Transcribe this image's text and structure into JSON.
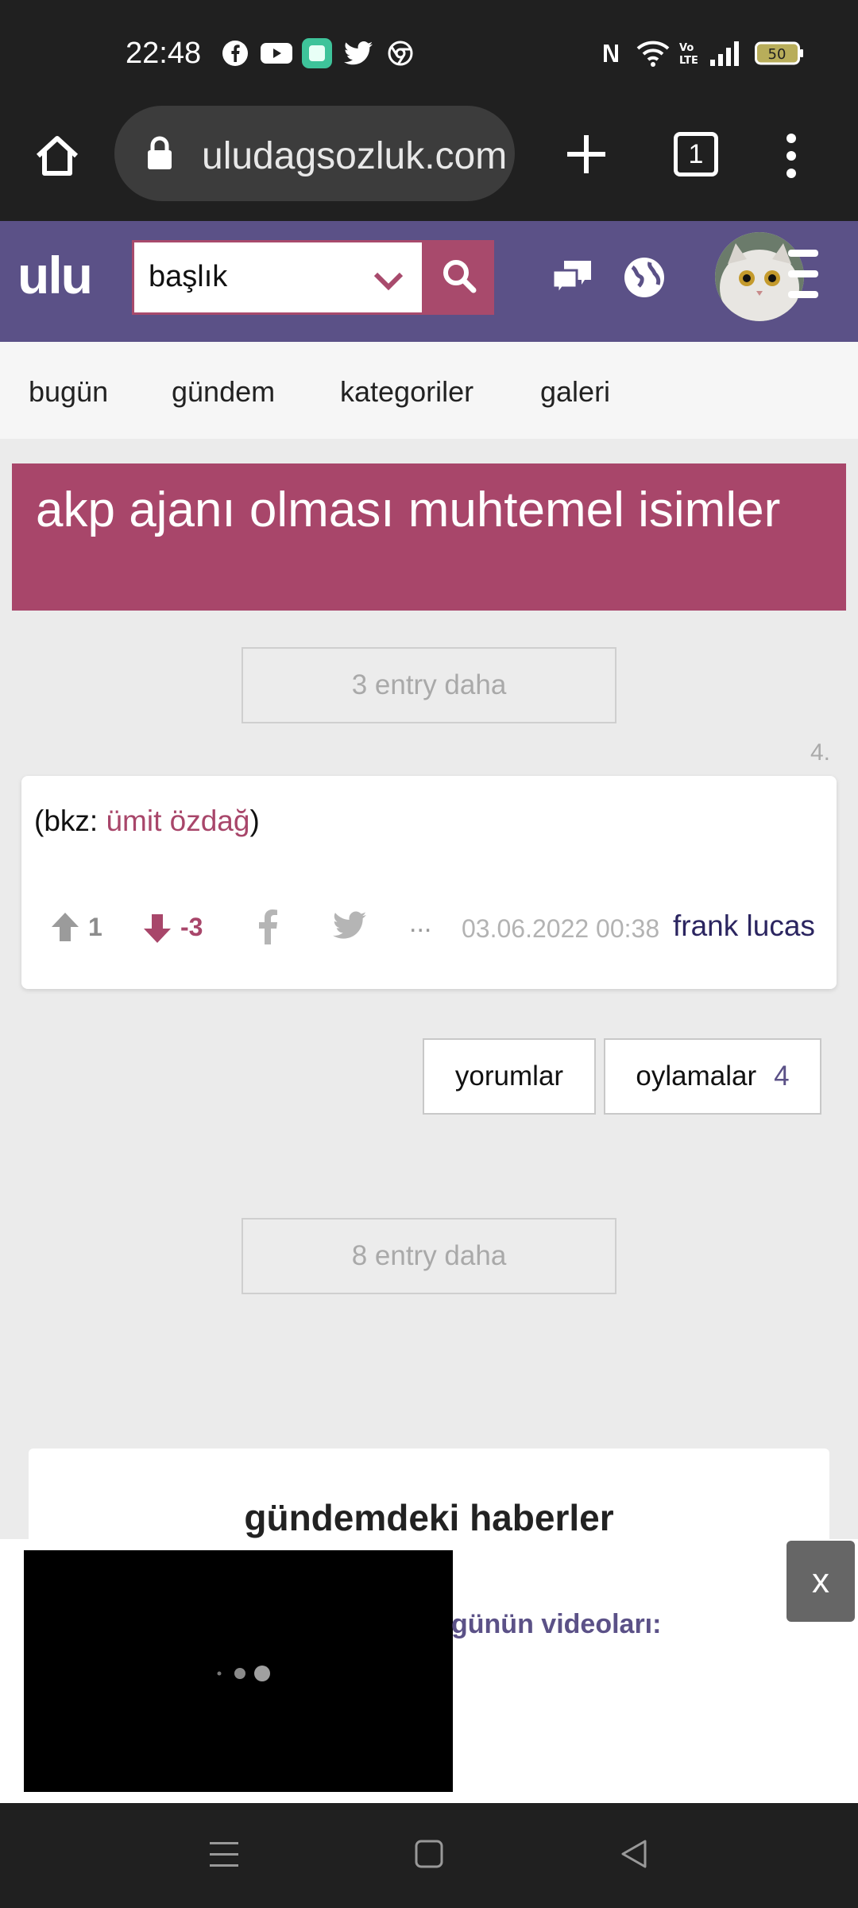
{
  "status": {
    "time": "22:48",
    "battery": "50",
    "notification_icons": [
      "facebook-icon",
      "youtube-icon",
      "app-icon",
      "twitter-icon",
      "chrome-icon"
    ]
  },
  "browser": {
    "url": "uludagsozluk.com",
    "tab_count": "1"
  },
  "header": {
    "logo": "ulu",
    "search_value": "başlık"
  },
  "nav": {
    "tabs": [
      "bugün",
      "gündem",
      "kategoriler",
      "galeri"
    ]
  },
  "topic": {
    "title": "akp ajanı olması muhtemel isimler",
    "more_before": "3 entry daha",
    "more_after": "8 entry daha"
  },
  "entry": {
    "number": "4.",
    "text_prefix": "(bkz: ",
    "link": "ümit özdağ",
    "text_suffix": ")",
    "upvotes": "1",
    "downvotes": "-3",
    "more": "...",
    "date": "03.06.2022 00:38",
    "author": "frank lucas"
  },
  "actions": {
    "comments": "yorumlar",
    "votes_label": "oylamalar",
    "votes_count": "4"
  },
  "news": {
    "heading": "gündemdeki haberler",
    "video_label": "günün videoları:",
    "close": "x"
  },
  "colors": {
    "brand": "#5b5187",
    "accent": "#a8466a"
  }
}
